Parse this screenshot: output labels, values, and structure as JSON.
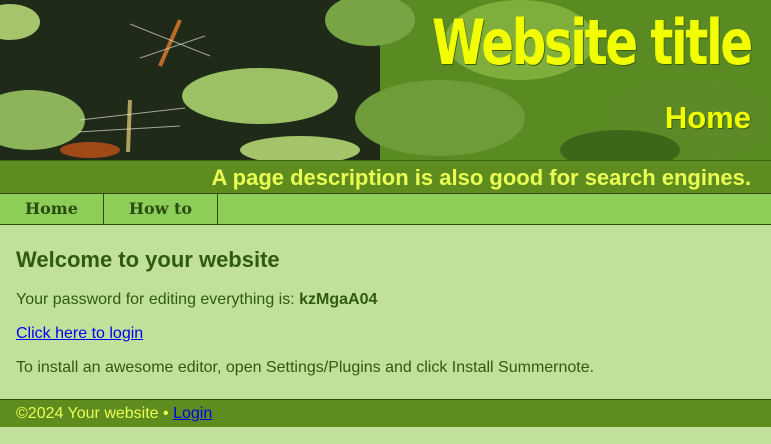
{
  "header": {
    "title": "Website title",
    "subtitle": "Home",
    "description": "A page description is also good for search engines."
  },
  "nav": {
    "items": [
      {
        "label": "Home"
      },
      {
        "label": "How to"
      }
    ]
  },
  "main": {
    "heading": "Welcome to your website",
    "password_prefix": "Your password for editing everything is: ",
    "password": "kzMgaA04",
    "login_link": "Click here to login",
    "editor_note": "To install an awesome editor, open Settings/Plugins and click Install Summernote."
  },
  "footer": {
    "copyright": "©2024 Your website",
    "separator": " • ",
    "login": "Login"
  },
  "colors": {
    "title_yellow": "#f2ff00",
    "bar_green": "#5e8c1f",
    "nav_green": "#8cce58",
    "page_bg": "#c1e09c",
    "text_green": "#2f5a10"
  }
}
